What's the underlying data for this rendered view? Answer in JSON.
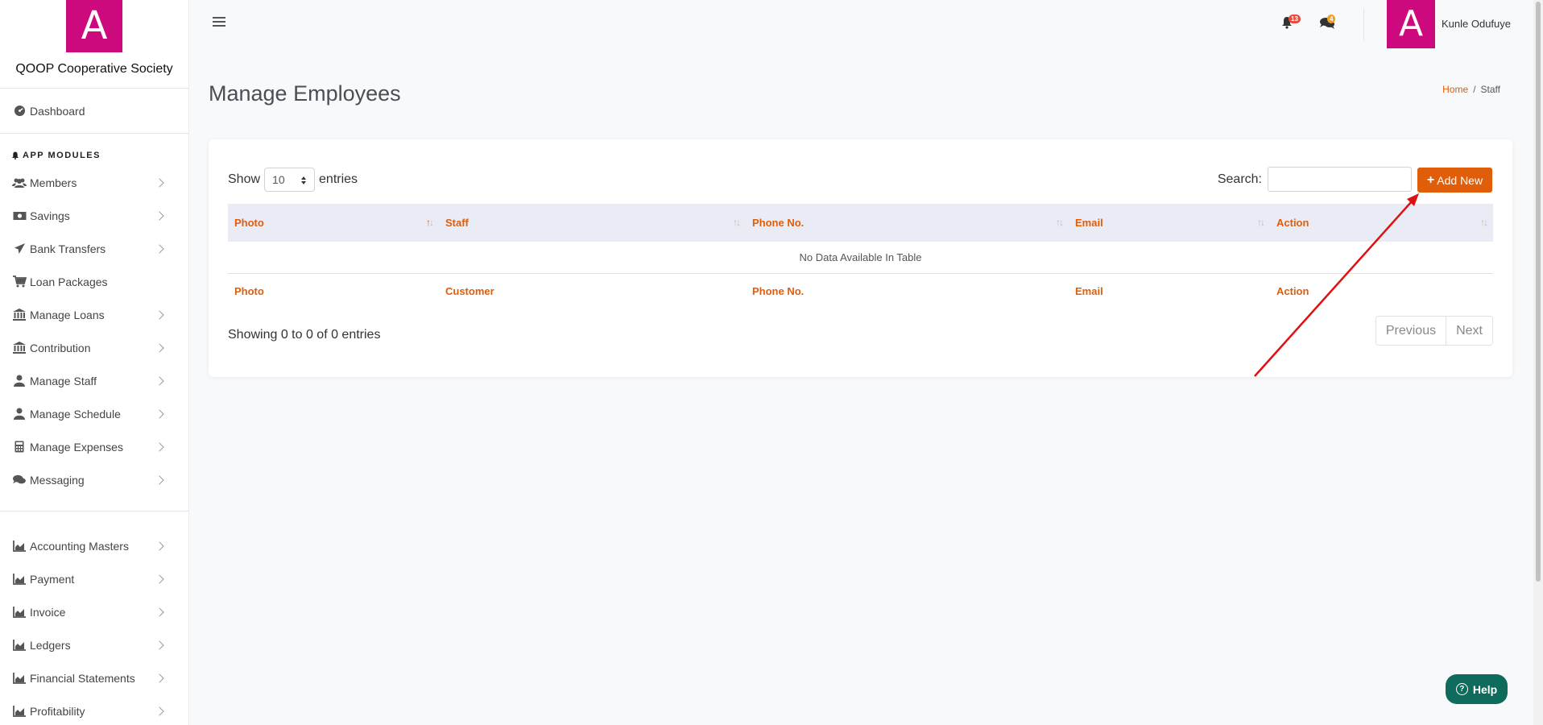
{
  "brand": {
    "logo_letter": "A",
    "name": "QOOP Cooperative Society"
  },
  "sidebar": {
    "dashboard": "Dashboard",
    "modules_heading": "APP MODULES",
    "items": [
      {
        "label": "Members",
        "icon": "users-icon",
        "chevron": true
      },
      {
        "label": "Savings",
        "icon": "money-icon",
        "chevron": true
      },
      {
        "label": "Bank Transfers",
        "icon": "paper-plane-icon",
        "chevron": true
      },
      {
        "label": "Loan Packages",
        "icon": "cart-icon",
        "chevron": false
      },
      {
        "label": "Manage Loans",
        "icon": "bank-icon",
        "chevron": true
      },
      {
        "label": "Contribution",
        "icon": "bank-icon",
        "chevron": true
      },
      {
        "label": "Manage Staff",
        "icon": "user-icon",
        "chevron": true
      },
      {
        "label": "Manage Schedule",
        "icon": "user-icon",
        "chevron": true
      },
      {
        "label": "Manage Expenses",
        "icon": "calculator-icon",
        "chevron": true
      },
      {
        "label": "Messaging",
        "icon": "comments-icon",
        "chevron": true
      }
    ],
    "accounting_items": [
      {
        "label": "Accounting Masters",
        "icon": "chart-icon"
      },
      {
        "label": "Payment",
        "icon": "chart-icon"
      },
      {
        "label": "Invoice",
        "icon": "chart-icon"
      },
      {
        "label": "Ledgers",
        "icon": "chart-icon"
      },
      {
        "label": "Financial Statements",
        "icon": "chart-icon"
      },
      {
        "label": "Profitability",
        "icon": "chart-icon"
      }
    ]
  },
  "topbar": {
    "notifications_count": "13",
    "messages_count": "4",
    "avatar_letter": "A",
    "user_name": "Kunle Odufuye"
  },
  "page": {
    "title": "Manage Employees",
    "breadcrumb_home": "Home",
    "breadcrumb_separator": "/",
    "breadcrumb_current": "Staff"
  },
  "table": {
    "show_label": "Show",
    "page_size": "10",
    "entries_label": "entries",
    "search_label": "Search:",
    "add_new_label": "Add New",
    "header": [
      "Photo",
      "Staff",
      "Phone No.",
      "Email",
      "Action"
    ],
    "empty_message": "No Data Available In Table",
    "footer": [
      "Photo",
      "Customer",
      "Phone No.",
      "Email",
      "Action"
    ],
    "info": "Showing 0 to 0 of 0 entries",
    "previous_label": "Previous",
    "next_label": "Next"
  },
  "help": {
    "label": "Help"
  },
  "colors": {
    "brand": "#cc0a7d",
    "accent": "#e05d0a",
    "help": "#0f6b5c",
    "annotation_arrow": "#e01010"
  }
}
